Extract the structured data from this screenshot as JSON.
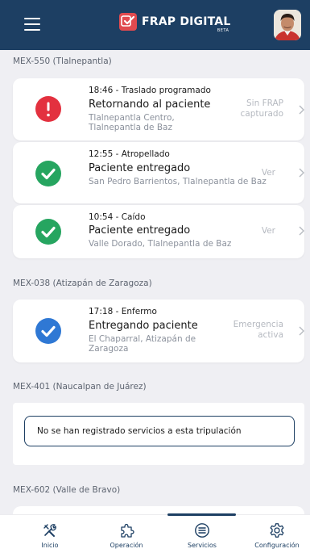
{
  "header": {
    "app_title": "FRAP DIGITAL",
    "beta_label": "BETA",
    "menu_icon": "hamburger-menu-icon",
    "logo_icon": "frap-logo-icon",
    "avatar": "user-avatar"
  },
  "sections": [
    {
      "label": "MEX-550 (Tlalnepantla)",
      "cards": [
        {
          "time": "18:46 - Traslado programado",
          "status": "Retornando al paciente",
          "address": "Tlalnepantla Centro, Tlalnepantla de Baz",
          "action": "Sin FRAP capturado",
          "icon": "alert-icon",
          "icon_color": "#e3313f"
        },
        {
          "time": "12:55 - Atropellado",
          "status": "Paciente entregado",
          "address": "San Pedro Barrientos, Tlalnepantla de Baz",
          "action": "Ver",
          "icon": "check-icon",
          "icon_color": "#26a560"
        },
        {
          "time": "10:54 - Caído",
          "status": "Paciente entregado",
          "address": "Valle Dorado, Tlalnepantla de Baz",
          "action": "Ver",
          "icon": "check-icon",
          "icon_color": "#26a560"
        }
      ]
    },
    {
      "label": "MEX-038 (Atizapán de Zaragoza)",
      "cards": [
        {
          "time": "17:18 - Enfermo",
          "status": "Entregando paciente",
          "address": "El Chaparral, Atizapán de Zaragoza",
          "action": "Emergencia activa",
          "icon": "check-icon",
          "icon_color": "#2f78d4"
        }
      ]
    },
    {
      "label": "MEX-401 (Naucalpan de Juárez)",
      "empty_message": "No se han registrado servicios a esta tripulación"
    },
    {
      "label": "MEX-602 (Valle de Bravo)"
    }
  ],
  "bottom_nav": [
    {
      "label": "Inicio",
      "icon": "tools-icon"
    },
    {
      "label": "Operación",
      "icon": "puzzle-icon"
    },
    {
      "label": "Servicios",
      "icon": "list-circle-icon",
      "active": true
    },
    {
      "label": "Configuración",
      "icon": "gear-icon"
    }
  ],
  "colors": {
    "primary": "#1d3f63",
    "background": "#efeff3",
    "alert": "#e3313f",
    "success": "#26a560",
    "active": "#2f78d4",
    "logo": "#e04a4f"
  }
}
